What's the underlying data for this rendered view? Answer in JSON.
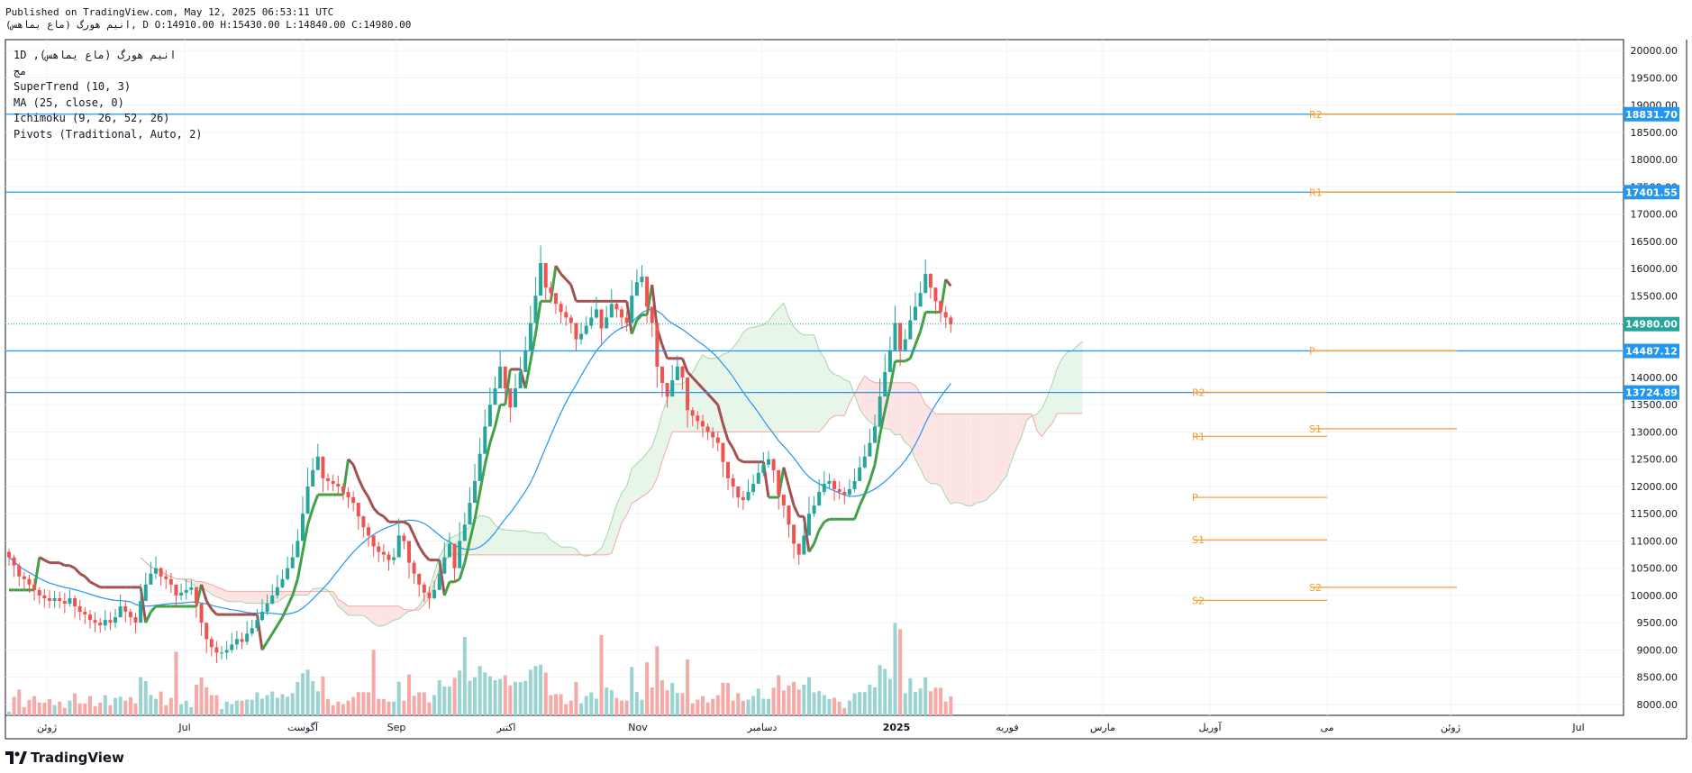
{
  "header": {
    "published": "Published on TradingView.com, May 12, 2025 06:53:11 UTC",
    "symbol_line": "انیم هورگ (ماع یماهس), D O:14910.00 H:15430.00 L:14840.00 C:14980.00"
  },
  "legend": {
    "symbol": "1D ,(ماع یماهس) انیم هورگ",
    "exchange": "مج",
    "supertrend": "SuperTrend (10, 3)",
    "ma": "MA (25, close, 0)",
    "ichimoku": "Ichimoku (9, 26, 52, 26)",
    "pivots": "Pivots (Traditional, Auto, 2)"
  },
  "branding": {
    "logo_text": "TradingView"
  },
  "chart_data": {
    "type": "candlestick",
    "y_range": [
      7800,
      20200
    ],
    "y_ticks": [
      "20000.00",
      "19500.00",
      "19000.00",
      "18500.00",
      "18000.00",
      "17500.00",
      "17000.00",
      "16500.00",
      "16000.00",
      "15500.00",
      "15000.00",
      "14500.00",
      "14000.00",
      "13500.00",
      "13000.00",
      "12500.00",
      "12000.00",
      "11500.00",
      "11000.00",
      "10500.00",
      "10000.00",
      "9500.00",
      "9000.00",
      "8500.00",
      "8000.00"
    ],
    "x_ticks": [
      {
        "label": "ژوئن",
        "bold": false
      },
      {
        "label": "Jul",
        "bold": false
      },
      {
        "label": "آگوست",
        "bold": false
      },
      {
        "label": "Sep",
        "bold": false
      },
      {
        "label": "اکتبر",
        "bold": false
      },
      {
        "label": "Nov",
        "bold": false
      },
      {
        "label": "دسامبر",
        "bold": false
      },
      {
        "label": "2025",
        "bold": true
      },
      {
        "label": "فوریه",
        "bold": false
      },
      {
        "label": "مارس",
        "bold": false
      },
      {
        "label": "آوریل",
        "bold": false
      },
      {
        "label": "می",
        "bold": false
      },
      {
        "label": "ژوئن",
        "bold": false
      },
      {
        "label": "Jul",
        "bold": false
      }
    ],
    "last_price": {
      "value": 14980,
      "label": "14980.00",
      "color": "#26a69a"
    },
    "horizontal_levels": [
      {
        "value": 18831.7,
        "label": "18831.70"
      },
      {
        "value": 17401.55,
        "label": "17401.55"
      },
      {
        "value": 14487.12,
        "label": "14487.12"
      },
      {
        "value": 13724.89,
        "label": "13724.89"
      }
    ],
    "pivots": [
      {
        "period": 1,
        "levels": [
          {
            "name": "R2",
            "value": 13730
          },
          {
            "name": "R1",
            "value": 12920
          },
          {
            "name": "P",
            "value": 11800
          },
          {
            "name": "S1",
            "value": 11020
          },
          {
            "name": "S2",
            "value": 9910
          }
        ]
      },
      {
        "period": 2,
        "levels": [
          {
            "name": "R2",
            "value": 18830
          },
          {
            "name": "R1",
            "value": 17400
          },
          {
            "name": "P",
            "value": 14490
          },
          {
            "name": "S1",
            "value": 13060
          },
          {
            "name": "S2",
            "value": 10150
          }
        ]
      }
    ],
    "series": [
      {
        "name": "Close",
        "values": [
          10700,
          10550,
          10350,
          10300,
          10200,
          10100,
          10000,
          9950,
          9900,
          9950,
          9900,
          9850,
          9950,
          9800,
          9700,
          9650,
          9550,
          9500,
          9450,
          9550,
          9500,
          9600,
          9800,
          9700,
          9600,
          9500,
          9900,
          10200,
          10400,
          10500,
          10350,
          10300,
          10200,
          10000,
          10050,
          10100,
          10150,
          9850,
          9500,
          9200,
          9050,
          8950,
          8950,
          9000,
          9100,
          9200,
          9150,
          9300,
          9400,
          9550,
          9700,
          9850,
          10000,
          10150,
          10300,
          10500,
          10700,
          11000,
          11500,
          12000,
          12300,
          12550,
          12150,
          12100,
          12050,
          12000,
          11900,
          11800,
          11700,
          11450,
          11250,
          11100,
          10900,
          10800,
          10750,
          10650,
          10700,
          11100,
          11000,
          10600,
          10400,
          10200,
          10050,
          9950,
          10100,
          10400,
          10700,
          10950,
          10500,
          11000,
          11300,
          11700,
          12100,
          12600,
          13100,
          13500,
          13800,
          14200,
          13800,
          13450,
          13800,
          14100,
          14500,
          15000,
          15500,
          16100,
          15650,
          15550,
          15350,
          15200,
          15100,
          15000,
          14700,
          14800,
          14950,
          15100,
          15250,
          14900,
          15100,
          15350,
          15250,
          15100,
          15000,
          15500,
          15750,
          15850,
          15300,
          15000,
          14200,
          13900,
          13650,
          13950,
          14200,
          14000,
          13400,
          13300,
          13200,
          13100,
          13000,
          12900,
          12800,
          12450,
          12150,
          12000,
          11800,
          11750,
          11900,
          12050,
          12250,
          12400,
          12500,
          12300,
          11850,
          11650,
          11300,
          10950,
          10750,
          11100,
          11500,
          11650,
          11900,
          12050,
          12100,
          11950,
          11900,
          11850,
          11950,
          12100,
          12350,
          12550,
          12800,
          13100,
          13650,
          14100,
          14500,
          15000,
          14500,
          14700,
          15050,
          15300,
          15550,
          15900,
          15650,
          15400,
          15200,
          15100,
          14980
        ]
      }
    ],
    "indicators": {
      "supertrend": "SuperTrend (10, 3)",
      "moving_average": "MA (25, close, 0)",
      "ichimoku": "Ichimoku (9, 26, 52, 26)"
    },
    "colors": {
      "up": "#26a69a",
      "down": "#ef5350",
      "supertrend_up": "#43a047",
      "supertrend_down": "#a1514f",
      "ma": "#2196f3",
      "level_line": "#2196f3",
      "pivot": "#f59f2f",
      "cloud_bull": "#e8f5e9",
      "cloud_bear": "#fde4e4"
    }
  }
}
